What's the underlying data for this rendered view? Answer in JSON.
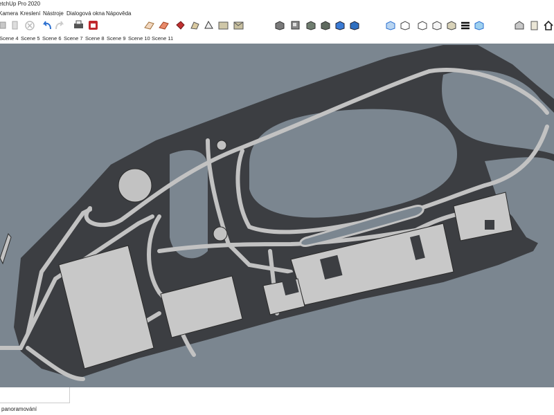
{
  "window": {
    "title": "etchUp Pro 2020"
  },
  "menu": [
    "Kamera",
    "Kreslení",
    "Nástroje",
    "Dialogová okna",
    "Nápověda"
  ],
  "scenes": [
    "Scene 4",
    "Scene 5",
    "Scene 6",
    "Scene 7",
    "Scene 8",
    "Scene 9",
    "Scene 10",
    "Scene 11"
  ],
  "toolbar": {
    "icons": [
      "push-pull-icon",
      "eraser-icon",
      "cancel-icon",
      "undo-icon",
      "redo-icon",
      "print-icon",
      "extension-warehouse-icon",
      "section-plane-icon",
      "section-fill-icon",
      "paint-bucket-icon",
      "follow-me-icon",
      "components-icon",
      "3d-warehouse-icon",
      "iso-view-icon",
      "top-view-icon",
      "front-view-icon",
      "right-view-icon",
      "back-view-icon",
      "left-view-icon",
      "xray-style-icon",
      "wireframe-style-icon",
      "hidden-line-style-icon",
      "shaded-style-icon",
      "shaded-textures-style-icon",
      "monochrome-style-icon",
      "iso-camera-icon",
      "layer-icon",
      "home-icon"
    ]
  },
  "viewport": {
    "background": "#7b8690"
  },
  "status": {
    "text": "panoramování"
  }
}
